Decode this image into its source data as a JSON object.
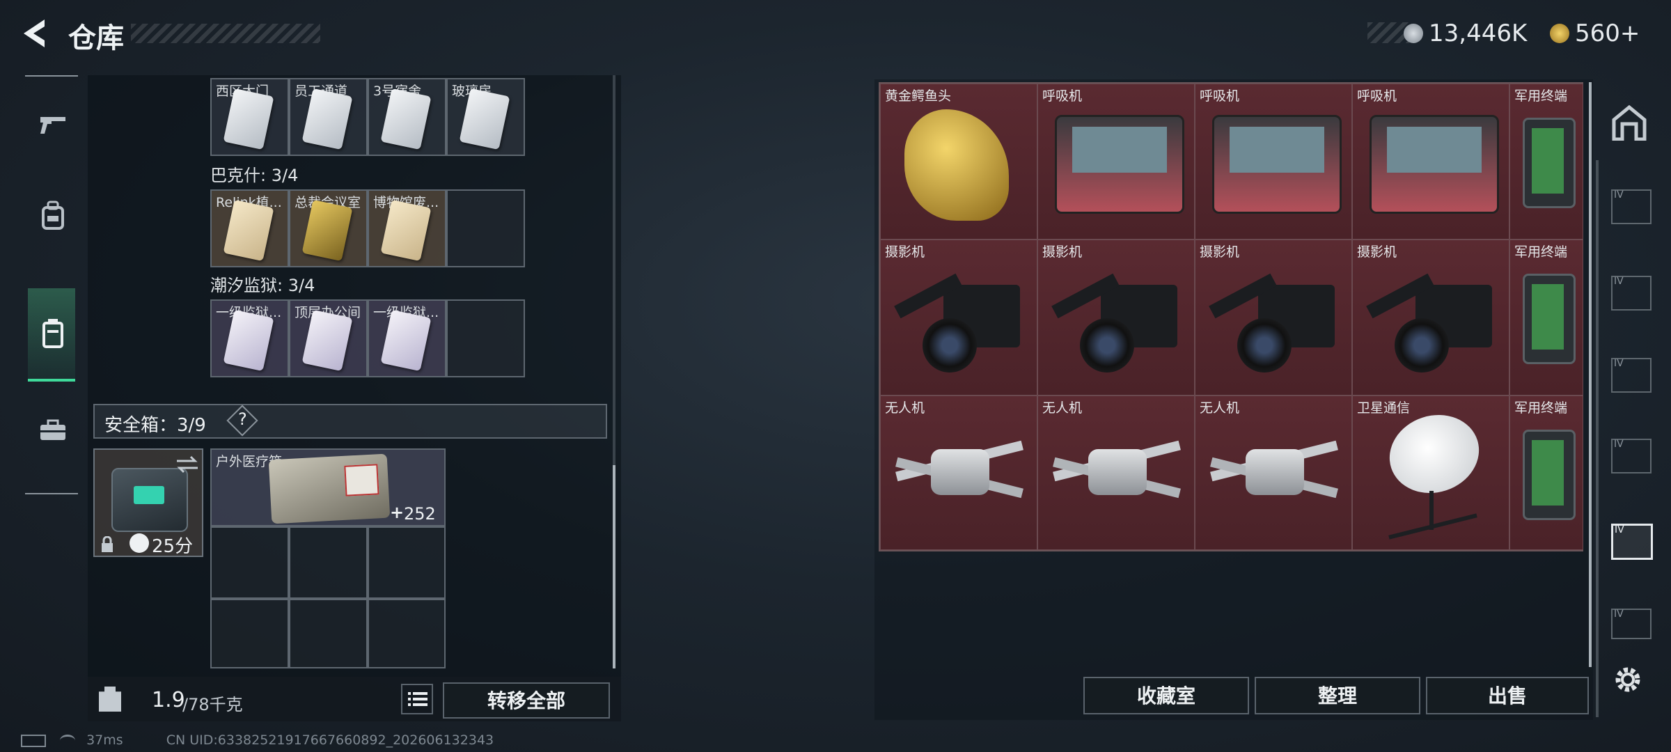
{
  "header": {
    "title": "仓库",
    "currency_primary": "13,446K",
    "currency_secondary": "560+"
  },
  "left_rail": [
    "weapon-tab",
    "backpack-tab",
    "container-tab",
    "toolbox-tab"
  ],
  "keycards": {
    "top_row": [
      "西区大门",
      "员工通道",
      "3号宿舍",
      "玻璃房"
    ],
    "groups": [
      {
        "title": "巴克什: 3/4",
        "items": [
          "Relink植...",
          "总裁会议室",
          "博物馆废..."
        ]
      },
      {
        "title": "潮汐监狱: 3/4",
        "items": [
          "一级监狱...",
          "顶层办公间",
          "一级监狱..."
        ]
      }
    ]
  },
  "safebox": {
    "label": "安全箱：3/9",
    "help": "?",
    "timer": "25分",
    "item_label": "户外医疗箱",
    "item_value": "252"
  },
  "bottom": {
    "weight_current": "1.9",
    "weight_max": "/78千克",
    "transfer_all": "转移全部"
  },
  "stash_grid": [
    [
      "黄金鳄鱼头",
      "呼吸机",
      "呼吸机",
      "呼吸机",
      "军用终端"
    ],
    [
      "摄影机",
      "摄影机",
      "摄影机",
      "摄影机",
      "军用终端"
    ],
    [
      "无人机",
      "无人机",
      "无人机",
      "卫星通信",
      "军用终端"
    ]
  ],
  "stash_actions": {
    "collection": "收藏室",
    "sort": "整理",
    "sell": "出售"
  },
  "right_rail_tabs": [
    "home-tab",
    "lv-case-1",
    "lv-case-2",
    "lv-case-3",
    "lv-case-4",
    "lv-case-5",
    "lv-case-6",
    "lv-case-7",
    "settings"
  ],
  "status": {
    "ping": "37ms",
    "uid": "CN UID:6338252191766766089​2_202606132343"
  }
}
